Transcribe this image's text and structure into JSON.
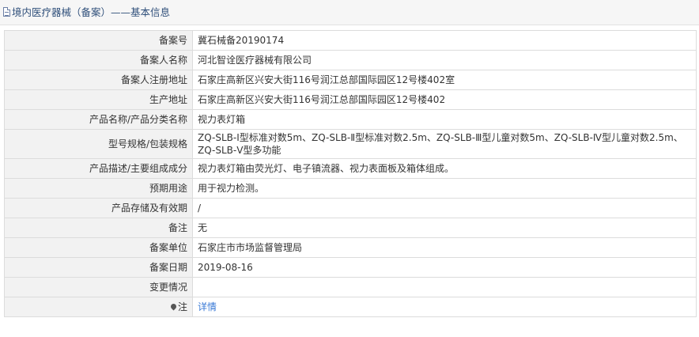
{
  "header": {
    "title": "境内医疗器械（备案）——基本信息"
  },
  "rows": [
    {
      "label": "备案号",
      "value": "冀石械备20190174"
    },
    {
      "label": "备案人名称",
      "value": "河北智诠医疗器械有限公司"
    },
    {
      "label": "备案人注册地址",
      "value": "石家庄高新区兴安大街116号润江总部国际园区12号楼402室"
    },
    {
      "label": "生产地址",
      "value": "石家庄高新区兴安大街116号润江总部国际园区12号楼402"
    },
    {
      "label": "产品名称/产品分类名称",
      "value": "视力表灯箱"
    },
    {
      "label": "型号规格/包装规格",
      "value": "ZQ-SLB-Ⅰ型标准对数5m、ZQ-SLB-Ⅱ型标准对数2.5m、ZQ-SLB-Ⅲ型儿童对数5m、ZQ-SLB-Ⅳ型儿童对数2.5m、ZQ-SLB-Ⅴ型多功能"
    },
    {
      "label": "产品描述/主要组成成分",
      "value": "视力表灯箱由荧光灯、电子镇流器、视力表面板及箱体组成。"
    },
    {
      "label": "预期用途",
      "value": "用于视力检测。"
    },
    {
      "label": "产品存储及有效期",
      "value": "/"
    },
    {
      "label": "备注",
      "value": "无"
    },
    {
      "label": "备案单位",
      "value": "石家庄市市场监督管理局"
    },
    {
      "label": "备案日期",
      "value": "2019-08-16"
    },
    {
      "label": "变更情况",
      "value": ""
    },
    {
      "label": "注",
      "value": "详情"
    }
  ],
  "colors": {
    "header_title": "#2f4f7a",
    "label_bg": "#f2f2f2",
    "border": "#dcdcdc",
    "link": "#3a7ad6"
  },
  "icons": [
    "document-icon",
    "map-pin-icon"
  ]
}
